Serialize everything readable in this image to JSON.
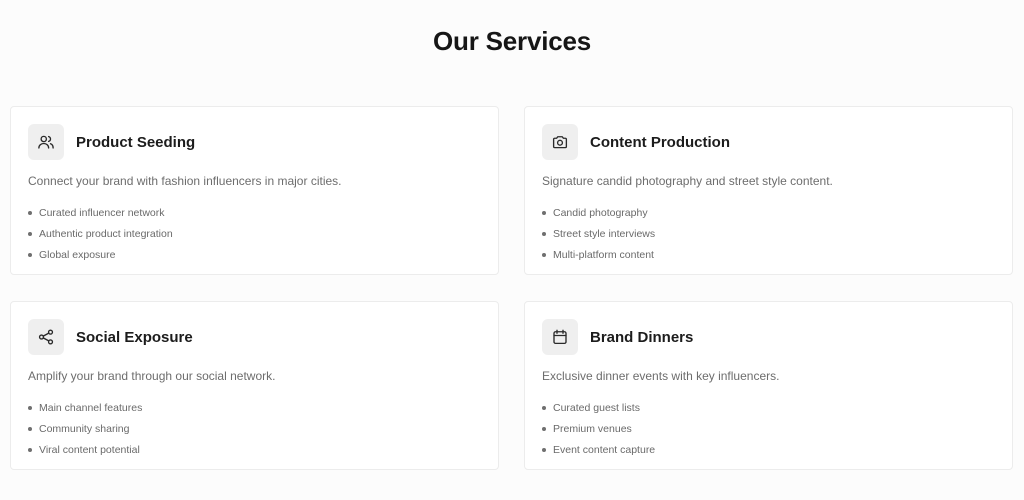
{
  "page": {
    "title": "Our Services"
  },
  "services": [
    {
      "title": "Product Seeding",
      "icon": "users-icon",
      "description": "Connect your brand with fashion influencers in major cities.",
      "features": [
        "Curated influencer network",
        "Authentic product integration",
        "Global exposure"
      ]
    },
    {
      "title": "Content Production",
      "icon": "camera-icon",
      "description": "Signature candid photography and street style content.",
      "features": [
        "Candid photography",
        "Street style interviews",
        "Multi-platform content"
      ]
    },
    {
      "title": "Social Exposure",
      "icon": "share-icon",
      "description": "Amplify your brand through our social network.",
      "features": [
        "Main channel features",
        "Community sharing",
        "Viral content potential"
      ]
    },
    {
      "title": "Brand Dinners",
      "icon": "calendar-icon",
      "description": "Exclusive dinner events with key influencers.",
      "features": [
        "Curated guest lists",
        "Premium venues",
        "Event content capture"
      ]
    }
  ],
  "colors": {
    "background": "#fcfcfc",
    "card_background": "#ffffff",
    "card_border": "#ececec",
    "icon_background": "#efefef",
    "title_text": "#161616",
    "muted_text": "#6d6d6d"
  }
}
